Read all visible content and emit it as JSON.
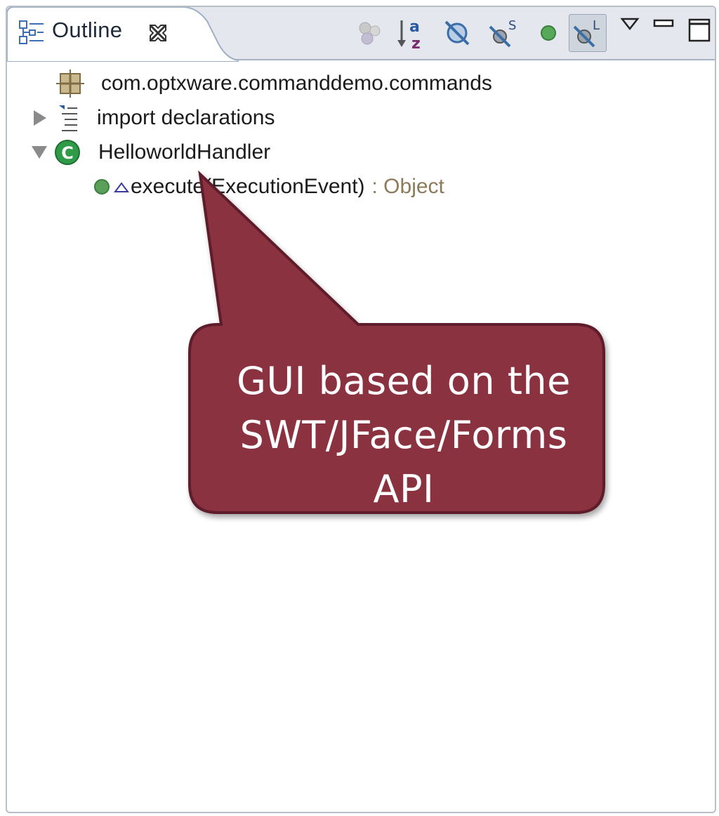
{
  "view": {
    "title": "Outline",
    "icon": "outline-view-icon",
    "close_icon": "close-icon"
  },
  "toolbar": {
    "items": [
      {
        "name": "hide-non-public-members-button",
        "icon": "grey-circles-icon",
        "active": false
      },
      {
        "name": "sort-button",
        "icon": "sort-az-icon",
        "active": false
      },
      {
        "name": "hide-fields-button",
        "icon": "hide-fields-icon",
        "active": false
      },
      {
        "name": "hide-static-members-button",
        "icon": "hide-static-icon",
        "active": false
      },
      {
        "name": "hide-non-public-button",
        "icon": "green-dot-icon",
        "active": false
      },
      {
        "name": "hide-local-types-button",
        "icon": "hide-local-types-icon",
        "active": true
      }
    ],
    "view_menu_icon": "view-menu-icon",
    "minimize_icon": "minimize-icon",
    "maximize_icon": "maximize-icon"
  },
  "tree": {
    "items": [
      {
        "label": "com.optxware.commanddemo.commands",
        "icon": "package-icon",
        "expand": "none"
      },
      {
        "label": "import declarations",
        "icon": "imports-icon",
        "expand": "collapsed"
      },
      {
        "label": "HelloworldHandler",
        "icon": "class-icon",
        "expand": "expanded"
      },
      {
        "label": "execute(ExecutionEvent)",
        "return_type": ": Object",
        "icon": "public-method-icon",
        "overlay_icon": "override-icon"
      }
    ]
  },
  "callout": {
    "lines": [
      "GUI based on the",
      "SWT/JFace/Forms",
      "API"
    ],
    "color": "#8b3040"
  },
  "colors": {
    "header_bg": "#e4e8ee",
    "tab_bg": "#ffffff",
    "return_type": "#8d7a5a",
    "class_icon": "#2f9a48",
    "method_dot": "#5aa05a"
  }
}
